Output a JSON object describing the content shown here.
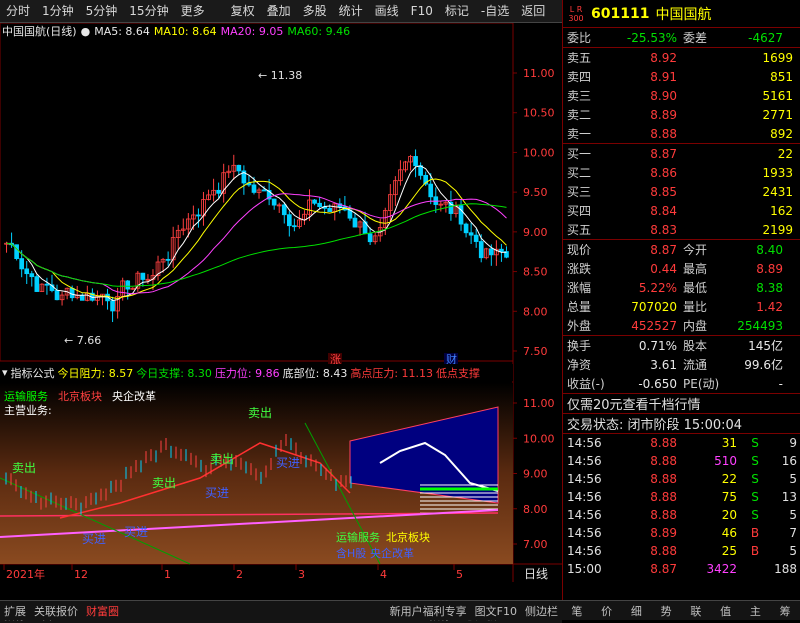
{
  "toolbar": {
    "items": [
      "分时",
      "1分钟",
      "5分钟",
      "15分钟",
      "更多",
      "复权",
      "叠加",
      "多股",
      "统计",
      "画线",
      "F10",
      "标记",
      "-自选",
      "返回"
    ]
  },
  "chart_header": {
    "title": "中国国航(日线)",
    "ma5": "MA5: 8.64",
    "ma10": "MA10: 8.64",
    "ma20": "MA20: 9.05",
    "ma60": "MA60: 9.46"
  },
  "indicator_header": {
    "name": "指标公式",
    "resist_today": "今日阻力: 8.57",
    "support_today": "今日支撑: 8.30",
    "pressure": "压力位: 9.86",
    "bottom": "底部位: 8.43",
    "high_pressure": "高点压力: 11.13",
    "low_support": "低点支撑"
  },
  "indicator_overlay": {
    "line1_a": "运输服务",
    "line1_b": "北京板块",
    "line1_c": "央企改革",
    "line2": "主营业务:",
    "bottom_a": "运输服务",
    "bottom_b": "北京板块",
    "bottom_c": "含H股",
    "bottom_d": "央企改革"
  },
  "signals": {
    "sell": "卖出",
    "buy": "买进"
  },
  "price_axis": [
    "11.00",
    "10.50",
    "10.00",
    "9.50",
    "9.00",
    "8.50",
    "8.00",
    "7.50"
  ],
  "ind_axis": [
    "11.00",
    "10.00",
    "9.00",
    "8.00",
    "7.00"
  ],
  "marks": {
    "high": "11.38",
    "low": "7.66",
    "zhang": "涨",
    "cai": "财"
  },
  "time_axis": [
    "2021年",
    "12",
    "1",
    "2",
    "3",
    "4",
    "5"
  ],
  "period": "日线",
  "bottom_tabs": [
    "指标A",
    "窗口",
    "MACD",
    "DMI",
    "DMA",
    "FSL",
    "TRIX",
    "BRAR",
    "CR",
    "VR",
    "OBV",
    "ASI",
    "EMV",
    "指标B",
    "模",
    "板"
  ],
  "status_bar": {
    "left": [
      "扩展",
      "关联报价",
      "财富圈"
    ],
    "mid": [
      "新用户福利专享",
      "图文F10",
      "侧边栏"
    ],
    "right": [
      "笔",
      "价",
      "细",
      "势",
      "联",
      "值",
      "主",
      "筹"
    ]
  },
  "stock": {
    "badge_top": "L R",
    "badge_num": "300",
    "code": "601111",
    "name": "中国国航",
    "weibi_label": "委比",
    "weibi": "-25.53%",
    "weicha_label": "委差",
    "weicha": "-4627",
    "asks": [
      {
        "label": "卖五",
        "price": "8.92",
        "vol": "1699"
      },
      {
        "label": "卖四",
        "price": "8.91",
        "vol": "851"
      },
      {
        "label": "卖三",
        "price": "8.90",
        "vol": "5161"
      },
      {
        "label": "卖二",
        "price": "8.89",
        "vol": "2771"
      },
      {
        "label": "卖一",
        "price": "8.88",
        "vol": "892"
      }
    ],
    "bids": [
      {
        "label": "买一",
        "price": "8.87",
        "vol": "22"
      },
      {
        "label": "买二",
        "price": "8.86",
        "vol": "1933"
      },
      {
        "label": "买三",
        "price": "8.85",
        "vol": "2431"
      },
      {
        "label": "买四",
        "price": "8.84",
        "vol": "162"
      },
      {
        "label": "买五",
        "price": "8.83",
        "vol": "2199"
      }
    ],
    "quote": [
      {
        "l1": "现价",
        "v1": "8.87",
        "c1": "red",
        "l2": "今开",
        "v2": "8.40",
        "c2": "green"
      },
      {
        "l1": "涨跌",
        "v1": "0.44",
        "c1": "red",
        "l2": "最高",
        "v2": "8.89",
        "c2": "red"
      },
      {
        "l1": "涨幅",
        "v1": "5.22%",
        "c1": "red",
        "l2": "最低",
        "v2": "8.38",
        "c2": "green"
      },
      {
        "l1": "总量",
        "v1": "707020",
        "c1": "yellow",
        "l2": "量比",
        "v2": "1.42",
        "c2": "red"
      },
      {
        "l1": "外盘",
        "v1": "452527",
        "c1": "red",
        "l2": "内盘",
        "v2": "254493",
        "c2": "green"
      }
    ],
    "extra": [
      {
        "l1": "换手",
        "v1": "0.71%",
        "l2": "股本",
        "v2": "145亿"
      },
      {
        "l1": "净资",
        "v1": "3.61",
        "l2": "流通",
        "v2": "99.6亿"
      },
      {
        "l1": "收益(-)",
        "v1": "-0.650",
        "l2": "PE(动)",
        "v2": "-"
      }
    ],
    "promo": "仅需20元查看千档行情",
    "trade_state": "交易状态: 闭市阶段 15:00:04",
    "ticks": [
      {
        "t": "14:56",
        "p": "8.88",
        "v": "31",
        "vc": "yellow",
        "d": "S",
        "n": "9"
      },
      {
        "t": "14:56",
        "p": "8.88",
        "v": "510",
        "vc": "magenta",
        "d": "S",
        "n": "16"
      },
      {
        "t": "14:56",
        "p": "8.88",
        "v": "22",
        "vc": "yellow",
        "d": "S",
        "n": "5"
      },
      {
        "t": "14:56",
        "p": "8.88",
        "v": "75",
        "vc": "yellow",
        "d": "S",
        "n": "13"
      },
      {
        "t": "14:56",
        "p": "8.88",
        "v": "20",
        "vc": "yellow",
        "d": "S",
        "n": "5"
      },
      {
        "t": "14:56",
        "p": "8.89",
        "v": "46",
        "vc": "yellow",
        "d": "B",
        "n": "7"
      },
      {
        "t": "14:56",
        "p": "8.88",
        "v": "25",
        "vc": "yellow",
        "d": "B",
        "n": "5"
      },
      {
        "t": "15:00",
        "p": "8.87",
        "v": "3422",
        "vc": "magenta",
        "d": "",
        "n": "188"
      }
    ]
  }
}
